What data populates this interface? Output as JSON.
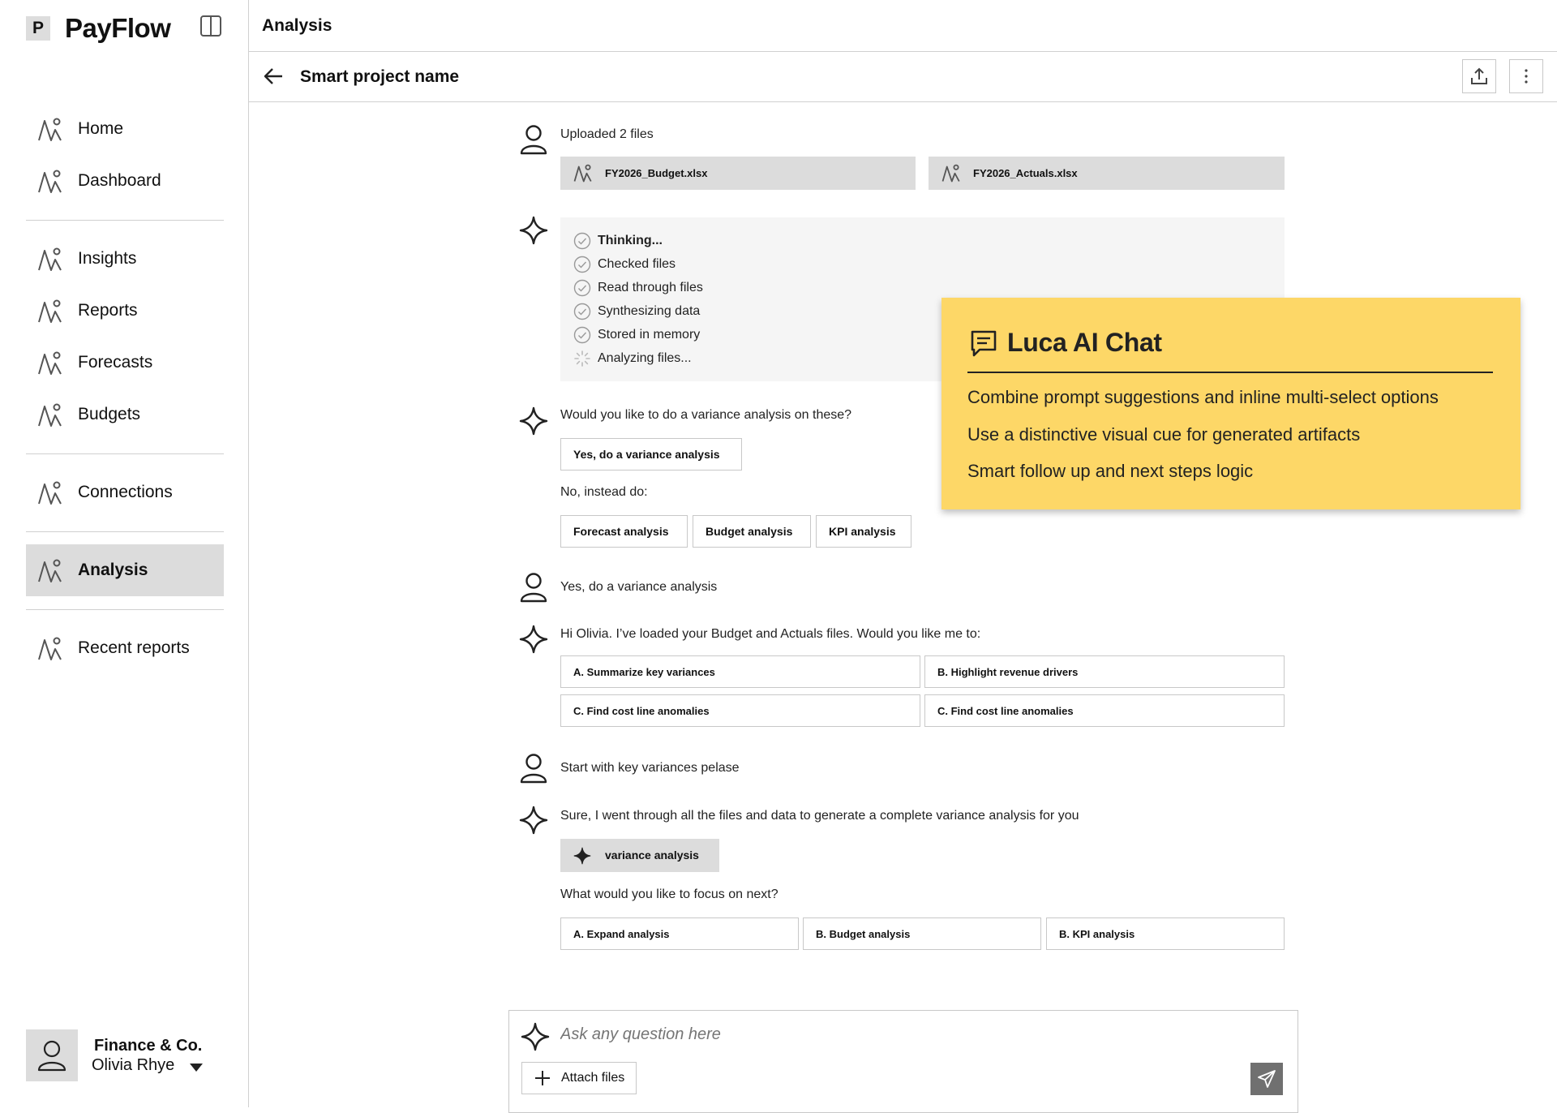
{
  "app": {
    "logo_letter": "P",
    "name": "PayFlow"
  },
  "sidebar": {
    "items": [
      {
        "label": "Home"
      },
      {
        "label": "Dashboard"
      },
      {
        "label": "Insights"
      },
      {
        "label": "Reports"
      },
      {
        "label": "Forecasts"
      },
      {
        "label": "Budgets"
      },
      {
        "label": "Connections"
      },
      {
        "label": "Analysis",
        "active": true
      },
      {
        "label": "Recent reports"
      }
    ],
    "account": {
      "org": "Finance & Co.",
      "user": "Olivia Rhye"
    }
  },
  "header": {
    "title": "Analysis",
    "project_name": "Smart project name"
  },
  "chat": {
    "upload_text": "Uploaded 2 files",
    "files": [
      "FY2026_Budget.xlsx",
      "FY2026_Actuals.xlsx"
    ],
    "thinking_steps": [
      {
        "label": "Thinking...",
        "state": "done"
      },
      {
        "label": "Checked files",
        "state": "done"
      },
      {
        "label": "Read through files",
        "state": "done"
      },
      {
        "label": "Synthesizing data",
        "state": "done"
      },
      {
        "label": "Stored in memory",
        "state": "done"
      },
      {
        "label": "Analyzing files...",
        "state": "loading"
      }
    ],
    "question1": "Would you like to do a variance analysis on these?",
    "primary_option": "Yes, do a variance analysis",
    "alt_label": "No, instead do:",
    "alt_options": [
      "Forecast analysis",
      "Budget analysis",
      "KPI analysis"
    ],
    "user_reply1": "Yes, do a variance analysis",
    "ai_message2": "Hi Olivia. I’ve loaded your Budget and Actuals files. Would you like me to:",
    "options2": [
      "A. Summarize key variances",
      "B. Highlight revenue drivers",
      "C. Find cost line anomalies",
      "C. Find cost line anomalies"
    ],
    "user_reply2": "Start with key variances pelase",
    "ai_message3": "Sure, I went through all the files and data to generate a complete variance analysis for you",
    "artifact_label": "variance analysis",
    "next_question": "What would you like to focus on next?",
    "next_options": [
      "A. Expand analysis",
      "B. Budget analysis",
      "B. KPI analysis"
    ]
  },
  "composer": {
    "placeholder": "Ask any question here",
    "attach_label": "Attach files"
  },
  "note": {
    "title": "Luca AI Chat",
    "items": [
      "Combine prompt suggestions and inline multi-select options",
      "Use a distinctive visual cue for generated artifacts",
      "Smart follow up and next steps logic"
    ],
    "color": "#fdd767"
  }
}
